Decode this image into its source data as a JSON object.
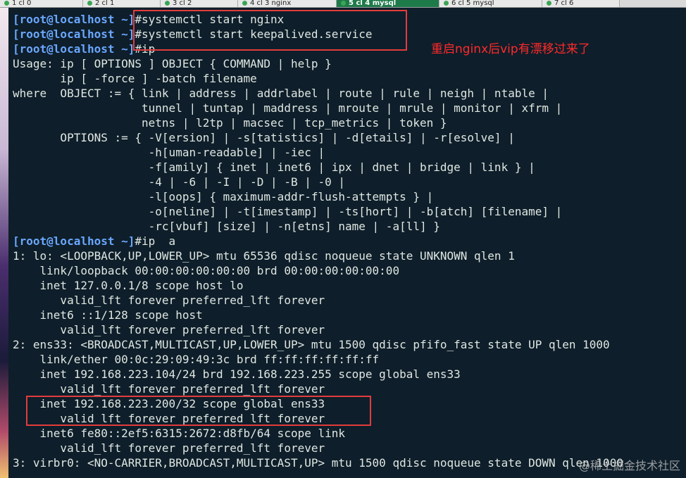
{
  "tabs": [
    {
      "label": "1 cl 0"
    },
    {
      "label": "2 cl 1"
    },
    {
      "label": "3 cl 2"
    },
    {
      "label": "4 cl 3 nginx"
    },
    {
      "label": "5 cl 4 mysql"
    },
    {
      "label": "6 cl 5 mysql"
    },
    {
      "label": "7 cl 6"
    }
  ],
  "prompt": "[root@localhost ~]",
  "terminal": {
    "lines": [
      {
        "prompt": "[root@localhost ~]",
        "text": "#systemctl start nginx"
      },
      {
        "prompt": "[root@localhost ~]",
        "text": "#systemctl start keepalived.service"
      },
      {
        "prompt": "[root@localhost ~]",
        "text": "#ip"
      },
      {
        "prompt": "",
        "text": "Usage: ip [ OPTIONS ] OBJECT { COMMAND | help }"
      },
      {
        "prompt": "",
        "text": "       ip [ -force ] -batch filename"
      },
      {
        "prompt": "",
        "text": "where  OBJECT := { link | address | addrlabel | route | rule | neigh | ntable |"
      },
      {
        "prompt": "",
        "text": "                   tunnel | tuntap | maddress | mroute | mrule | monitor | xfrm |"
      },
      {
        "prompt": "",
        "text": "                   netns | l2tp | macsec | tcp_metrics | token }"
      },
      {
        "prompt": "",
        "text": "       OPTIONS := { -V[ersion] | -s[tatistics] | -d[etails] | -r[esolve] |"
      },
      {
        "prompt": "",
        "text": "                    -h[uman-readable] | -iec |"
      },
      {
        "prompt": "",
        "text": "                    -f[amily] { inet | inet6 | ipx | dnet | bridge | link } |"
      },
      {
        "prompt": "",
        "text": "                    -4 | -6 | -I | -D | -B | -0 |"
      },
      {
        "prompt": "",
        "text": "                    -l[oops] { maximum-addr-flush-attempts } |"
      },
      {
        "prompt": "",
        "text": "                    -o[neline] | -t[imestamp] | -ts[hort] | -b[atch] [filename] |"
      },
      {
        "prompt": "",
        "text": "                    -rc[vbuf] [size] | -n[etns] name | -a[ll] }"
      },
      {
        "prompt": "[root@localhost ~]",
        "text": "#ip  a"
      },
      {
        "prompt": "",
        "text": "1: lo: <LOOPBACK,UP,LOWER_UP> mtu 65536 qdisc noqueue state UNKNOWN qlen 1"
      },
      {
        "prompt": "",
        "text": "    link/loopback 00:00:00:00:00:00 brd 00:00:00:00:00:00"
      },
      {
        "prompt": "",
        "text": "    inet 127.0.0.1/8 scope host lo"
      },
      {
        "prompt": "",
        "text": "       valid_lft forever preferred_lft forever"
      },
      {
        "prompt": "",
        "text": "    inet6 ::1/128 scope host"
      },
      {
        "prompt": "",
        "text": "       valid_lft forever preferred_lft forever"
      },
      {
        "prompt": "",
        "text": "2: ens33: <BROADCAST,MULTICAST,UP,LOWER_UP> mtu 1500 qdisc pfifo_fast state UP qlen 1000"
      },
      {
        "prompt": "",
        "text": "    link/ether 00:0c:29:09:49:3c brd ff:ff:ff:ff:ff:ff"
      },
      {
        "prompt": "",
        "text": "    inet 192.168.223.104/24 brd 192.168.223.255 scope global ens33"
      },
      {
        "prompt": "",
        "text": "       valid_lft forever preferred_lft forever"
      },
      {
        "prompt": "",
        "text": "    inet 192.168.223.200/32 scope global ens33"
      },
      {
        "prompt": "",
        "text": "       valid_lft forever preferred_lft forever"
      },
      {
        "prompt": "",
        "text": "    inet6 fe80::2ef5:6315:2672:d8fb/64 scope link"
      },
      {
        "prompt": "",
        "text": "       valid_lft forever preferred_lft forever"
      },
      {
        "prompt": "",
        "text": "3: virbr0: <NO-CARRIER,BROADCAST,MULTICAST,UP> mtu 1500 qdisc noqueue state DOWN qlen 1000"
      }
    ]
  },
  "annotation": "重启nginx后vip有漂移过来了",
  "watermark": "@稀土掘金技术社区",
  "colors": {
    "terminal_bg": "#0e1e2a",
    "text": "#dfe7e2",
    "prompt": "#6aa7ff",
    "highlight_box": "#e23c3c",
    "annotation": "#ff2a2a"
  }
}
